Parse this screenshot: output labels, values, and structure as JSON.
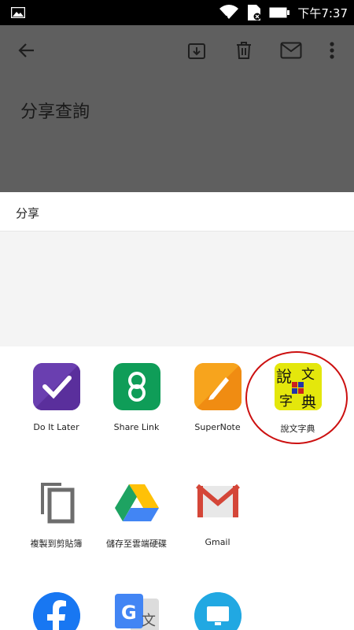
{
  "status_bar": {
    "time": "下午7:37",
    "icons": [
      "image-icon",
      "wifi-icon",
      "sim-icon",
      "battery-icon"
    ]
  },
  "email": {
    "subject": "分享查詢",
    "toolbar": [
      "back-arrow-icon",
      "archive-icon",
      "delete-icon",
      "mail-icon",
      "more-vert-icon"
    ]
  },
  "share": {
    "title": "分享",
    "apps": [
      {
        "label": "Do It Later"
      },
      {
        "label": "Share Link"
      },
      {
        "label": "SuperNote"
      },
      {
        "label": "說文字典",
        "icon_text": [
          "說",
          "文",
          "字",
          "典"
        ]
      },
      {
        "label": "複製到剪貼簿"
      },
      {
        "label": "儲存至雲端硬碟"
      },
      {
        "label": "Gmail"
      },
      {
        "label": ""
      },
      {
        "label": ""
      },
      {
        "label": ""
      }
    ]
  },
  "colors": {
    "dim_overlay": "#5f5f5f",
    "do_it_later": "#6a3fb0",
    "share_link": "#0f9d58",
    "supernote": "#f7a41d",
    "shuowen_bg": "#e4e70c",
    "highlight_ring": "#cc1010",
    "facebook": "#1877f2",
    "remote_desktop": "#21a8e2"
  }
}
